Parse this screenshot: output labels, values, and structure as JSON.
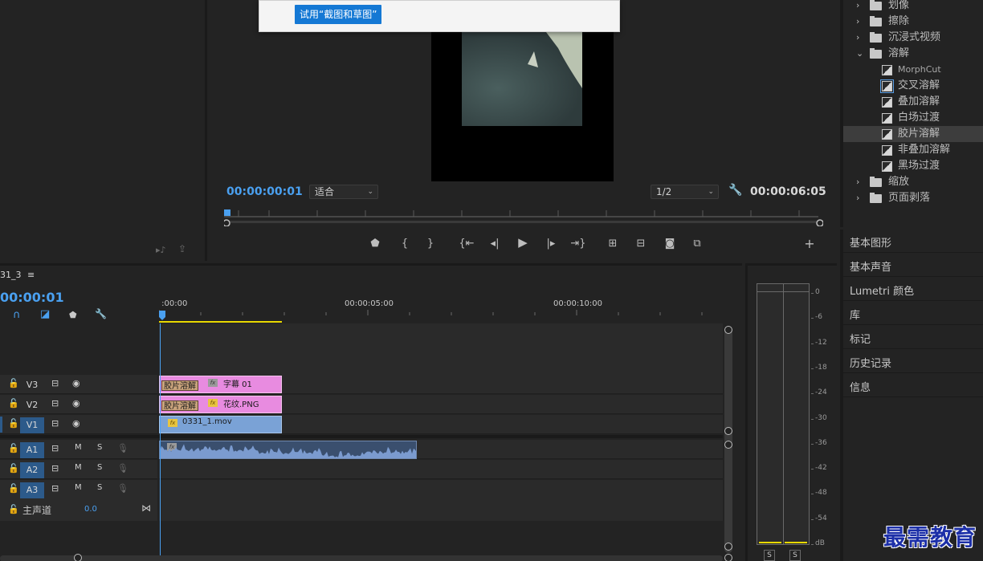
{
  "popup": {
    "button_label": "试用“截图和草图”"
  },
  "program": {
    "current_tc": "00:00:00:01",
    "fit": "适合",
    "resolution": "1/2",
    "duration_tc": "00:00:06:05"
  },
  "effects": {
    "items": [
      {
        "type": "folder",
        "label": "划像",
        "expanded": false
      },
      {
        "type": "folder",
        "label": "擦除",
        "expanded": false
      },
      {
        "type": "folder",
        "label": "沉浸式视频",
        "expanded": false
      },
      {
        "type": "folder",
        "label": "溶解",
        "expanded": true
      },
      {
        "type": "effect",
        "label": "MorphCut"
      },
      {
        "type": "effect",
        "label": "交叉溶解"
      },
      {
        "type": "effect",
        "label": "叠加溶解"
      },
      {
        "type": "effect",
        "label": "白场过渡"
      },
      {
        "type": "effect",
        "label": "胶片溶解",
        "selected": true
      },
      {
        "type": "effect",
        "label": "非叠加溶解"
      },
      {
        "type": "effect",
        "label": "黑场过渡"
      },
      {
        "type": "folder",
        "label": "缩放",
        "expanded": false
      },
      {
        "type": "folder",
        "label": "页面剥落",
        "expanded": false
      }
    ]
  },
  "panels": [
    "基本图形",
    "基本声音",
    "Lumetri 颜色",
    "库",
    "标记",
    "历史记录",
    "信息"
  ],
  "timeline": {
    "sequence_name": "31_3",
    "current_tc": "00:00:01",
    "ruler": [
      " :00:00",
      "00:00:05:00",
      "00:00:10:00"
    ],
    "video_tracks": [
      {
        "name": "V3",
        "clip": "字幕 01",
        "transition": "胶片溶解",
        "fx_color": "gray"
      },
      {
        "name": "V2",
        "clip": "花纹.PNG",
        "transition": "胶片溶解",
        "fx_color": "yellow"
      },
      {
        "name": "V1",
        "clip": "0331_1.mov",
        "transition": "",
        "fx_color": "yellow"
      }
    ],
    "audio_tracks": [
      "A1",
      "A2",
      "A3"
    ],
    "audio_m": "M",
    "audio_s": "S",
    "master": {
      "label": "主声道",
      "value": "0.0"
    }
  },
  "meter": {
    "scale": [
      "0",
      "-6",
      "-12",
      "-18",
      "-24",
      "-30",
      "-36",
      "-42",
      "-48",
      "-54",
      "dB"
    ],
    "solo": "S"
  },
  "watermark": "最需教育"
}
